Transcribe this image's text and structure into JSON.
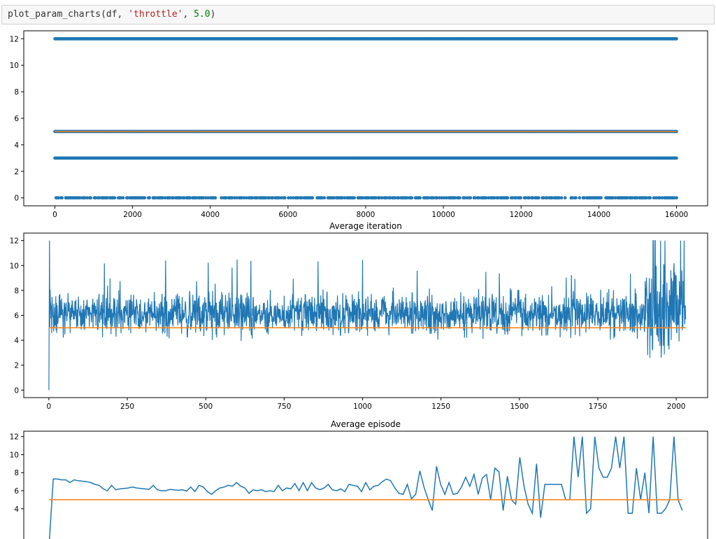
{
  "code": {
    "func": "plot_param_charts",
    "open": "(",
    "arg1": "df",
    "sep1": ", ",
    "arg2": "'throttle'",
    "sep2": ", ",
    "arg3": "5.0",
    "close": ")"
  },
  "colors": {
    "series": "#1f77b4",
    "reference": "#ff7f0e",
    "axis": "#000000"
  },
  "chart_data": [
    {
      "type": "scatter",
      "title": "",
      "xlim": [
        -800,
        16800
      ],
      "ylim": [
        -0.6,
        12.6
      ],
      "xticks": [
        0,
        2000,
        4000,
        6000,
        8000,
        10000,
        12000,
        14000,
        16000
      ],
      "yticks": [
        0,
        2,
        4,
        6,
        8,
        10,
        12
      ],
      "series": [
        {
          "kind": "points",
          "levels": [
            0,
            3,
            5,
            12
          ],
          "x_range": [
            0,
            16000
          ]
        },
        {
          "kind": "reference_line",
          "y": 5.0
        }
      ]
    },
    {
      "type": "line",
      "title": "Average iteration",
      "xlim": [
        -80,
        2100
      ],
      "ylim": [
        -0.6,
        12.6
      ],
      "xticks": [
        0,
        250,
        500,
        750,
        1000,
        1250,
        1500,
        1750,
        2000
      ],
      "yticks": [
        0,
        2,
        4,
        6,
        8,
        10,
        12
      ],
      "n_points": 2031,
      "series": [
        {
          "kind": "line",
          "range": [
            0,
            12
          ],
          "approx_mean": 6.2
        },
        {
          "kind": "reference_line",
          "y": 5.0
        }
      ]
    },
    {
      "type": "line",
      "title": "Average episode",
      "xlim": [
        -8,
        208
      ],
      "ylim": [
        -0.6,
        12.6
      ],
      "yticks": [
        4,
        6,
        8,
        10,
        12
      ],
      "series": [
        {
          "kind": "line",
          "y": [
            0,
            7.3,
            7.3,
            7.2,
            7.2,
            6.9,
            7.2,
            7.1,
            7.05,
            7.0,
            6.9,
            6.7,
            6.6,
            6.2,
            6.0,
            6.6,
            6.1,
            6.2,
            6.25,
            6.3,
            6.4,
            6.3,
            6.25,
            6.2,
            6.15,
            6.6,
            6.1,
            6.0,
            6.0,
            6.15,
            6.1,
            6.05,
            6.1,
            5.95,
            6.4,
            5.9,
            6.6,
            6.4,
            5.9,
            5.6,
            6.0,
            6.3,
            6.4,
            6.6,
            6.5,
            6.9,
            6.5,
            6.3,
            5.7,
            6.1,
            6.0,
            6.1,
            5.9,
            6.0,
            5.9,
            6.6,
            6.0,
            6.3,
            6.2,
            6.8,
            6.0,
            6.9,
            6.0,
            6.9,
            6.3,
            6.1,
            6.3,
            6.7,
            6.1,
            6.0,
            6.2,
            5.9,
            6.7,
            6.6,
            6.5,
            5.9,
            6.9,
            6.1,
            6.5,
            6.6,
            7.0,
            7.3,
            7.1,
            6.3,
            5.7,
            5.6,
            6.7,
            5.1,
            5.6,
            8.2,
            6.4,
            5.0,
            3.8,
            8.7,
            6.7,
            5.6,
            6.9,
            5.6,
            5.7,
            6.4,
            7.5,
            6.5,
            7.8,
            5.6,
            7.4,
            7.8,
            5.0,
            8.5,
            8.1,
            3.8,
            7.6,
            5.0,
            4.5,
            9.7,
            6.5,
            4.5,
            3.5,
            9.0,
            3.0,
            6.7,
            6.7,
            6.7,
            6.7,
            6.7,
            5.0,
            5.0,
            12.0,
            7.5,
            12.0,
            3.5,
            4.0,
            12.0,
            8.5,
            7.5,
            7.5,
            8.5,
            12.0,
            8.5,
            12.0,
            3.5,
            3.5,
            8.5,
            5.0,
            8.0,
            3.5,
            12.0,
            3.5,
            3.5,
            4.0,
            5.0,
            12.0,
            5.0,
            3.8
          ]
        },
        {
          "kind": "reference_line",
          "y": 5.0
        }
      ]
    }
  ]
}
